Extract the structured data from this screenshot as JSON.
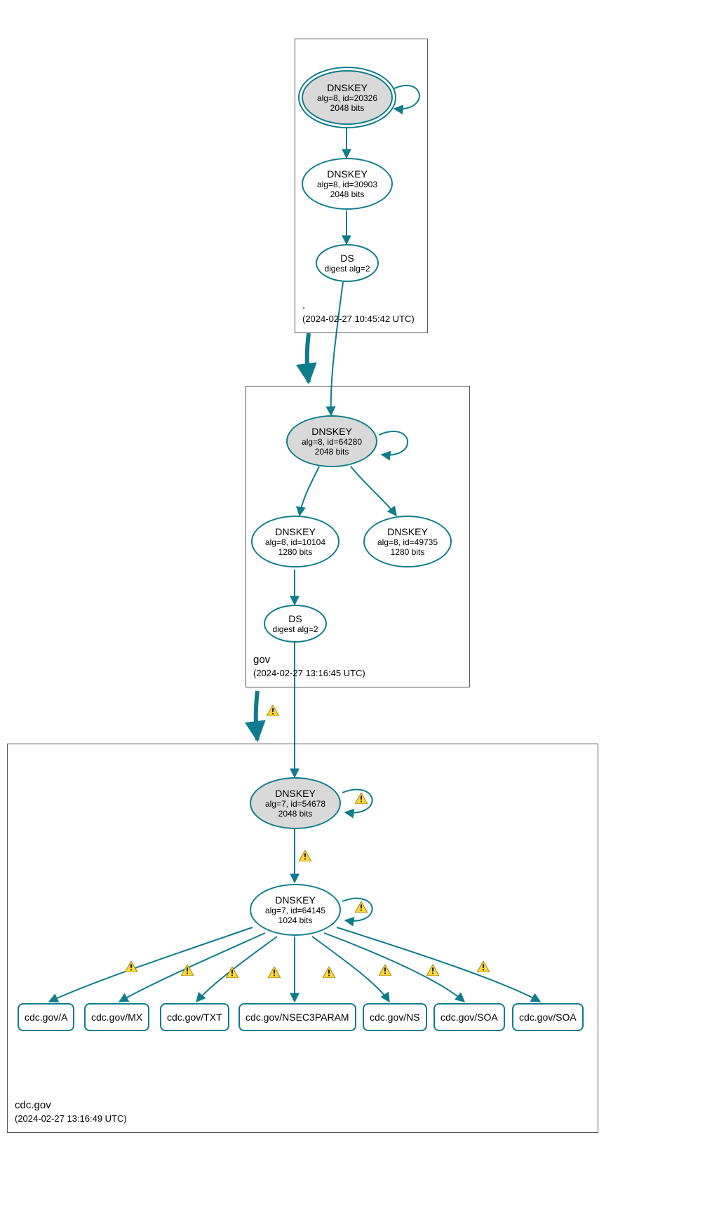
{
  "zones": {
    "root": {
      "name": ".",
      "timestamp": "(2024-02-27 10:45:42 UTC)"
    },
    "gov": {
      "name": "gov",
      "timestamp": "(2024-02-27 13:16:45 UTC)"
    },
    "cdcgov": {
      "name": "cdc.gov",
      "timestamp": "(2024-02-27 13:16:49 UTC)"
    }
  },
  "nodes": {
    "root_ksk": {
      "title": "DNSKEY",
      "line2": "alg=8, id=20326",
      "line3": "2048 bits"
    },
    "root_zsk": {
      "title": "DNSKEY",
      "line2": "alg=8, id=30903",
      "line3": "2048 bits"
    },
    "root_ds": {
      "title": "DS",
      "line2": "digest alg=2"
    },
    "gov_ksk": {
      "title": "DNSKEY",
      "line2": "alg=8, id=64280",
      "line3": "2048 bits"
    },
    "gov_zsk1": {
      "title": "DNSKEY",
      "line2": "alg=8, id=10104",
      "line3": "1280 bits"
    },
    "gov_zsk2": {
      "title": "DNSKEY",
      "line2": "alg=8, id=49735",
      "line3": "1280 bits"
    },
    "gov_ds": {
      "title": "DS",
      "line2": "digest alg=2"
    },
    "cdc_ksk": {
      "title": "DNSKEY",
      "line2": "alg=7, id=54678",
      "line3": "2048 bits"
    },
    "cdc_zsk": {
      "title": "DNSKEY",
      "line2": "alg=7, id=64145",
      "line3": "1024 bits"
    },
    "rr_a": {
      "label": "cdc.gov/A"
    },
    "rr_mx": {
      "label": "cdc.gov/MX"
    },
    "rr_txt": {
      "label": "cdc.gov/TXT"
    },
    "rr_nsec3p": {
      "label": "cdc.gov/NSEC3PARAM"
    },
    "rr_ns": {
      "label": "cdc.gov/NS"
    },
    "rr_soa1": {
      "label": "cdc.gov/SOA"
    },
    "rr_soa2": {
      "label": "cdc.gov/SOA"
    }
  },
  "colors": {
    "stroke": "#0f7c8c",
    "sepFill": "#d9d9d9",
    "zoneBorder": "#555555",
    "warnFill": "#ffd83b",
    "warnStroke": "#a07400"
  }
}
